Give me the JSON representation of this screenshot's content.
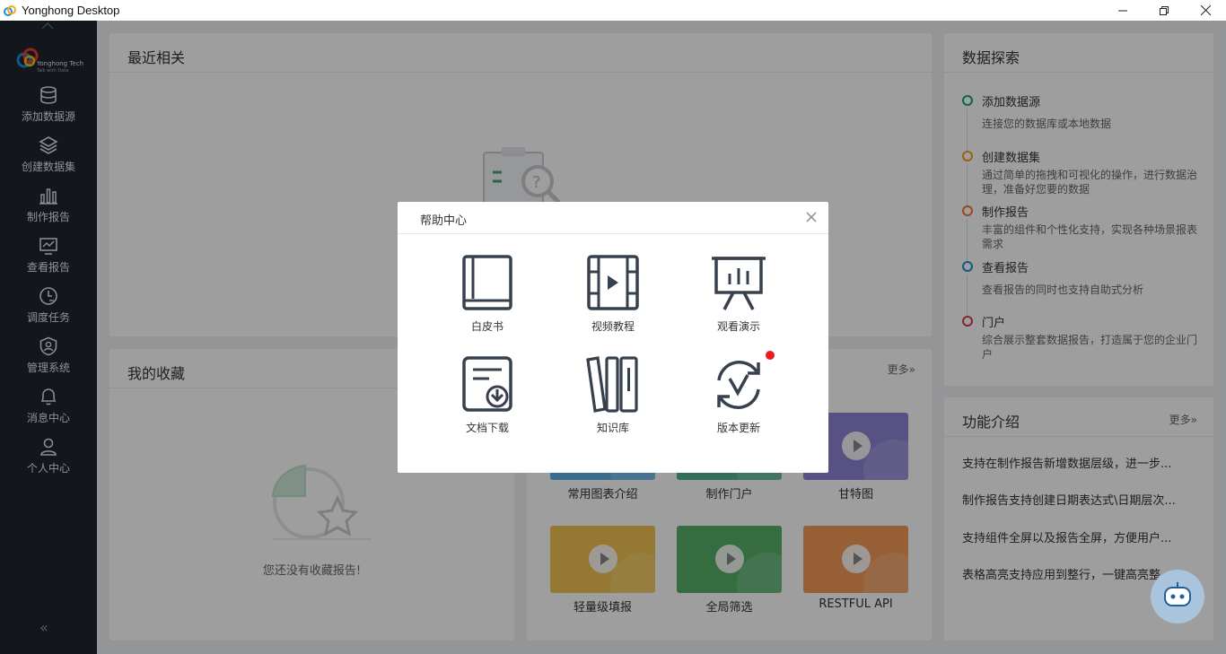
{
  "window": {
    "title": "Yonghong Desktop"
  },
  "brand": {
    "name": "Yonghong Tech",
    "slogan": "Talk with Data"
  },
  "sidebar": {
    "items": [
      {
        "label": "添加数据源",
        "icon": "database-icon"
      },
      {
        "label": "创建数据集",
        "icon": "layers-icon"
      },
      {
        "label": "制作报告",
        "icon": "bar-chart-icon"
      },
      {
        "label": "查看报告",
        "icon": "monitor-chart-icon"
      },
      {
        "label": "调度任务",
        "icon": "clock-schedule-icon"
      },
      {
        "label": "管理系统",
        "icon": "shield-user-icon"
      },
      {
        "label": "消息中心",
        "icon": "bell-icon"
      },
      {
        "label": "个人中心",
        "icon": "user-icon"
      }
    ],
    "collapse": "«"
  },
  "recent": {
    "title": "最近相关"
  },
  "favorites": {
    "title": "我的收藏",
    "empty_text": "您还没有收藏报告!"
  },
  "videos": {
    "more": "更多»",
    "items": [
      {
        "label": "常用图表介绍",
        "color": "#5db1e4"
      },
      {
        "label": "制作门户",
        "color": "#4fb38b"
      },
      {
        "label": "甘特图",
        "color": "#8f84d6"
      },
      {
        "label": "轻量级填报",
        "color": "#f0c24f"
      },
      {
        "label": "全局筛选",
        "color": "#56b06a"
      },
      {
        "label": "RESTFUL API",
        "color": "#f29a57"
      }
    ]
  },
  "explore": {
    "title": "数据探索",
    "steps": [
      {
        "name": "添加数据源",
        "desc": "连接您的数据库或本地数据",
        "color": "#1aa06d"
      },
      {
        "name": "创建数据集",
        "desc": "通过简单的拖拽和可视化的操作，进行数据治理，准备好您要的数据",
        "color": "#f0a020"
      },
      {
        "name": "制作报告",
        "desc": "丰富的组件和个性化支持，实现各种场景报表需求",
        "color": "#f07830"
      },
      {
        "name": "查看报告",
        "desc": "查看报告的同时也支持自助式分析",
        "color": "#1a90c8"
      },
      {
        "name": "门户",
        "desc": "综合展示整套数据报告，打造属于您的企业门户",
        "color": "#d04050"
      }
    ]
  },
  "features": {
    "title": "功能介绍",
    "more": "更多»",
    "items": [
      "支持在制作报告新增数据层级，进一步...",
      "制作报告支持创建日期表达式\\日期层次...",
      "支持组件全屏以及报告全屏，方便用户...",
      "表格高亮支持应用到整行，一键高亮整..."
    ]
  },
  "help_modal": {
    "title": "帮助中心",
    "items": [
      {
        "label": "白皮书",
        "icon": "book-icon"
      },
      {
        "label": "视频教程",
        "icon": "film-icon"
      },
      {
        "label": "观看演示",
        "icon": "presentation-icon"
      },
      {
        "label": "文档下载",
        "icon": "document-download-icon"
      },
      {
        "label": "知识库",
        "icon": "library-icon"
      },
      {
        "label": "版本更新",
        "icon": "refresh-check-icon"
      }
    ]
  }
}
